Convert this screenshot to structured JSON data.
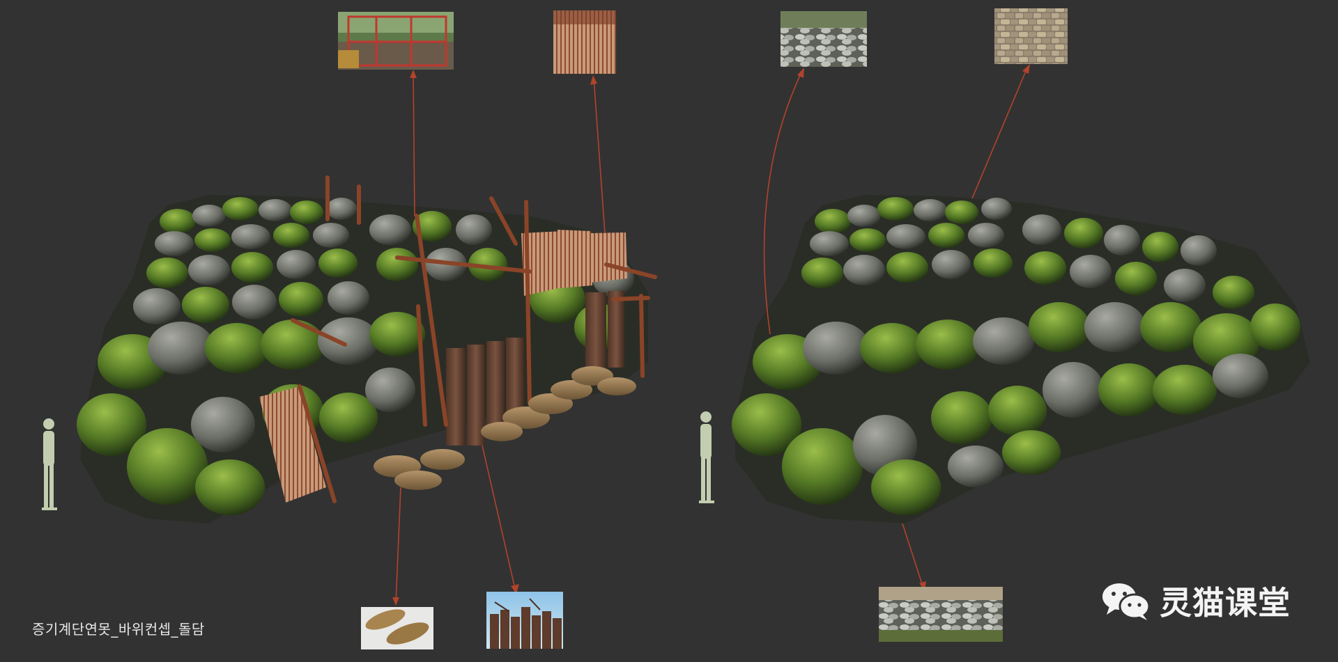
{
  "caption": "증기계단연못_바위컨셉_돌담",
  "watermark": {
    "text": "灵猫课堂",
    "icon": "wechat-icon"
  },
  "colors": {
    "background": "#323232",
    "arrow": "#b2432c",
    "moss": "#6f8f34",
    "stone": "#8a8d86",
    "rust": "#8a4a2a",
    "silhouette": "#c3cdb0"
  },
  "concepts": [
    {
      "name": "ruined-wall-with-fence",
      "references": [
        "red-metal-frame-photo",
        "corrugated-rusty-sheet-photo",
        "sandbags-photo",
        "broken-wooden-fence-photo"
      ]
    },
    {
      "name": "clean-stone-wall",
      "references": [
        "low-stone-wall-photo",
        "stacked-stone-texture-photo",
        "dry-stone-wall-photo"
      ]
    }
  ]
}
